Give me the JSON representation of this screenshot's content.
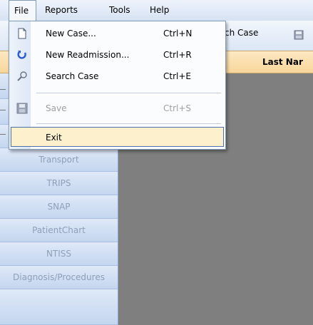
{
  "menubar": {
    "items": [
      {
        "label": "File"
      },
      {
        "label": "Reports"
      },
      {
        "label": "Tools"
      },
      {
        "label": "Help"
      }
    ]
  },
  "toolbar": {
    "search_case_partial": "arch Case"
  },
  "header": {
    "last_name_partial": "Last Nar"
  },
  "file_menu": {
    "items": [
      {
        "label": "New Case...",
        "shortcut": "Ctrl+N",
        "icon": "new-document-icon"
      },
      {
        "label": "New Readmission...",
        "shortcut": "Ctrl+R",
        "icon": "readmission-icon"
      },
      {
        "label": "Search Case",
        "shortcut": "Ctrl+E",
        "icon": "search-icon"
      },
      {
        "label": "Save",
        "shortcut": "Ctrl+S",
        "icon": "save-icon",
        "disabled": true
      },
      {
        "label": "Exit",
        "shortcut": ""
      }
    ]
  },
  "sidebar": {
    "items": [
      {
        "label": "Transport"
      },
      {
        "label": "TRIPS"
      },
      {
        "label": "SNAP"
      },
      {
        "label": "PatientChart"
      },
      {
        "label": "NTISS"
      },
      {
        "label": "Diagnosis/Procedures"
      }
    ]
  },
  "colors": {
    "menu_highlight": "#fdf0cd",
    "header_bg": "#f8d69b",
    "content_bg": "#7f7f7f",
    "sidebar_text": "#8f9fb8"
  }
}
